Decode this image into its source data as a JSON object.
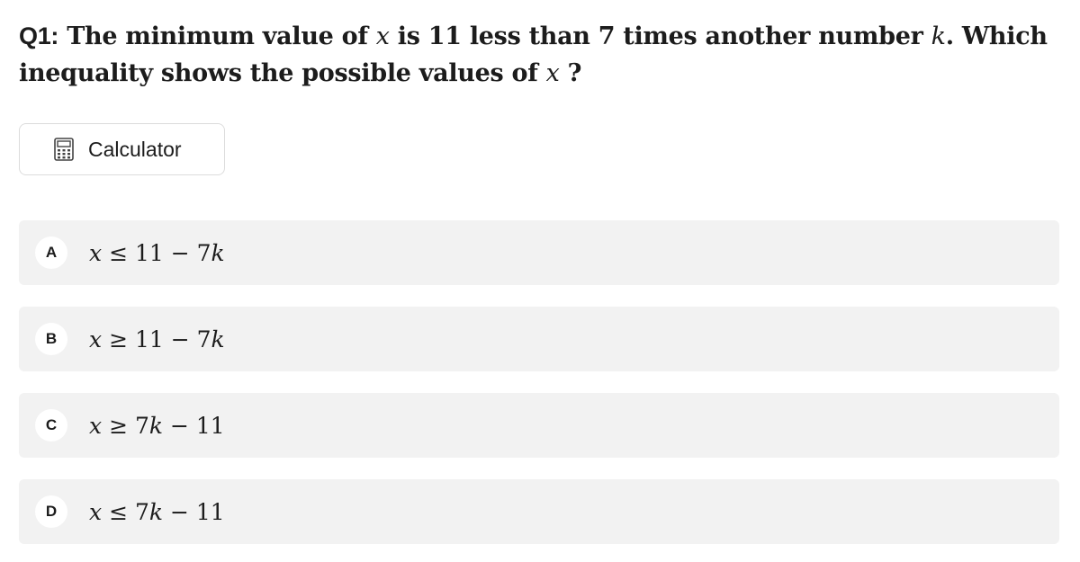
{
  "question": {
    "number": "Q1:",
    "part1": " The minimum value of ",
    "var1": "x",
    "part2": " is 11 less than 7 times another number ",
    "var2": "k",
    "part3": ". Which inequality shows the possible values of ",
    "var3": "x",
    "part4": " ?"
  },
  "calculator": {
    "label": "Calculator",
    "icon": "calculator-icon"
  },
  "options": [
    {
      "letter": "A",
      "expression": "x ≤ 11 − 7k"
    },
    {
      "letter": "B",
      "expression": "x ≥ 11 − 7k"
    },
    {
      "letter": "C",
      "expression": "x ≥ 7k − 11"
    },
    {
      "letter": "D",
      "expression": "x ≤ 7k − 11"
    }
  ]
}
